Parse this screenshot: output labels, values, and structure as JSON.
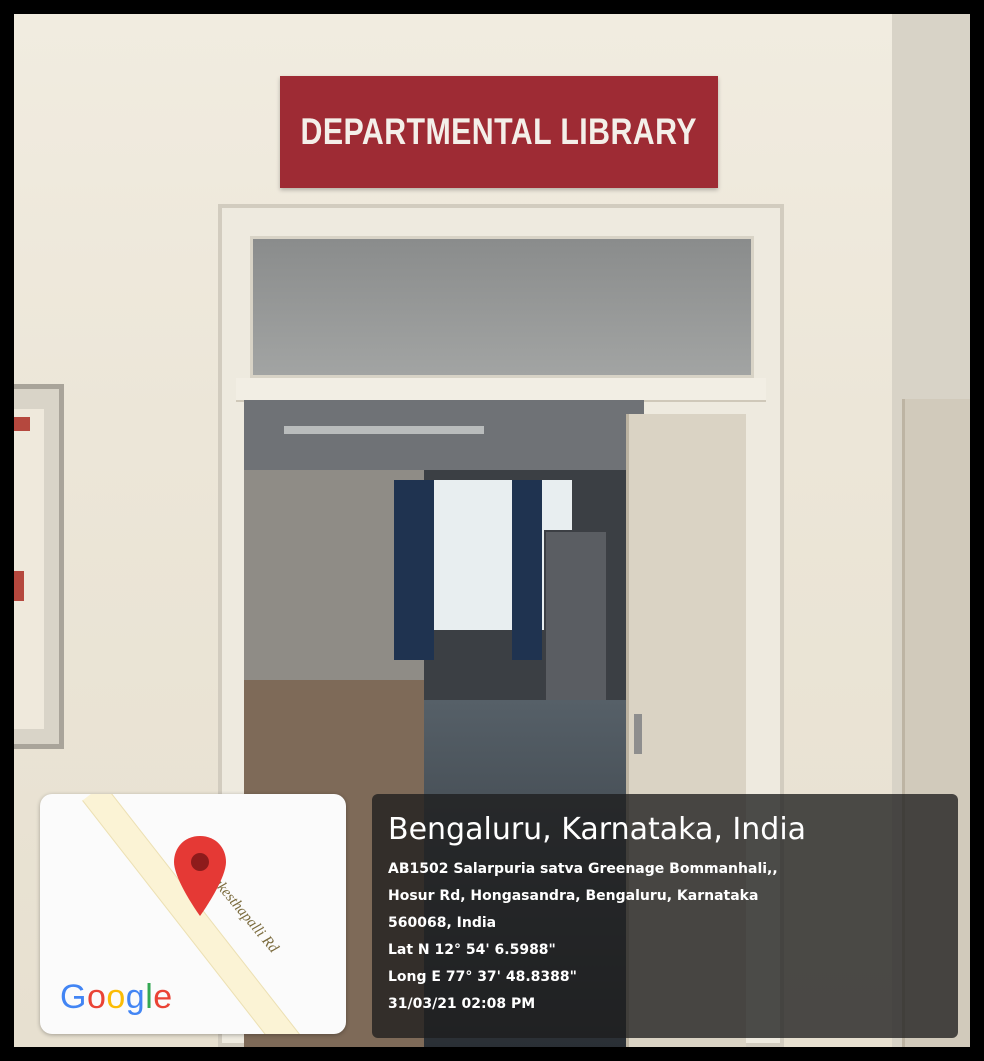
{
  "photo": {
    "sign": {
      "text": "DEPARTMENTAL LIBRARY",
      "color": "#9e2b34"
    }
  },
  "map_card": {
    "road_label": "Chennakesthapalli Rd",
    "pin_icon": "map-pin-icon",
    "logo_text": "Google",
    "logo_letters": [
      "G",
      "o",
      "o",
      "g",
      "l",
      "e"
    ]
  },
  "location_card": {
    "city": "Bengaluru, Karnataka, India",
    "address_line1": "AB1502 Salarpuria satva Greenage Bommanhali,,",
    "address_line2": "Hosur Rd, Hongasandra, Bengaluru, Karnataka",
    "address_line3": "560068, India",
    "latitude": "Lat N 12° 54' 6.5988\"",
    "longitude": "Long E 77° 37' 48.8388\"",
    "timestamp": "31/03/21 02:08 PM"
  }
}
